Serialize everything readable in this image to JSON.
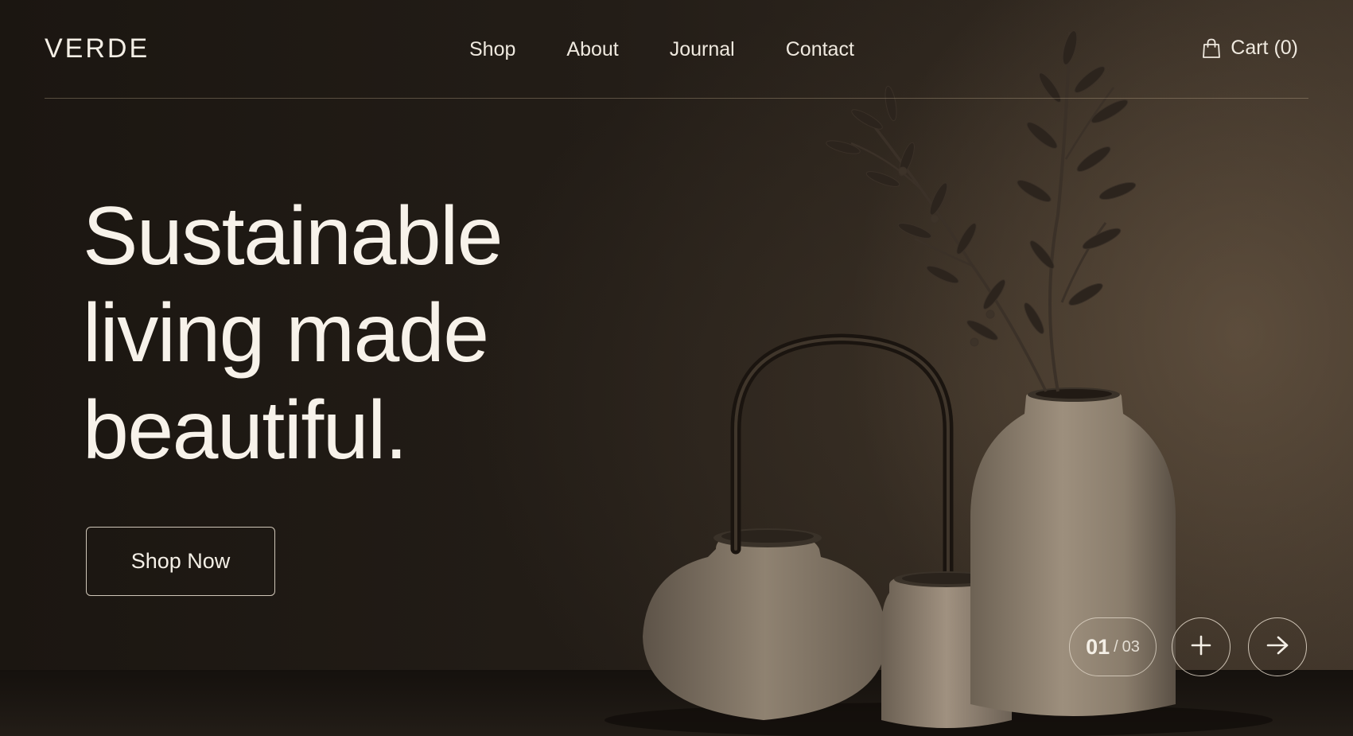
{
  "brand": {
    "name": "VERDE"
  },
  "nav": {
    "items": [
      {
        "label": "Shop"
      },
      {
        "label": "About"
      },
      {
        "label": "Journal"
      },
      {
        "label": "Contact"
      }
    ]
  },
  "cart": {
    "label": "Cart (0)",
    "icon": "shopping-bag-icon"
  },
  "hero": {
    "headline": [
      "Sustainable",
      "living made",
      "beautiful."
    ],
    "cta_label": "Shop Now"
  },
  "slider": {
    "current": "01",
    "separator": "/",
    "total": "03",
    "plus_icon": "plus-icon",
    "next_icon": "arrow-right-icon"
  },
  "colors": {
    "background": "#1c1712",
    "text": "#f4efe6",
    "ceramic": "#9c8e7c"
  }
}
